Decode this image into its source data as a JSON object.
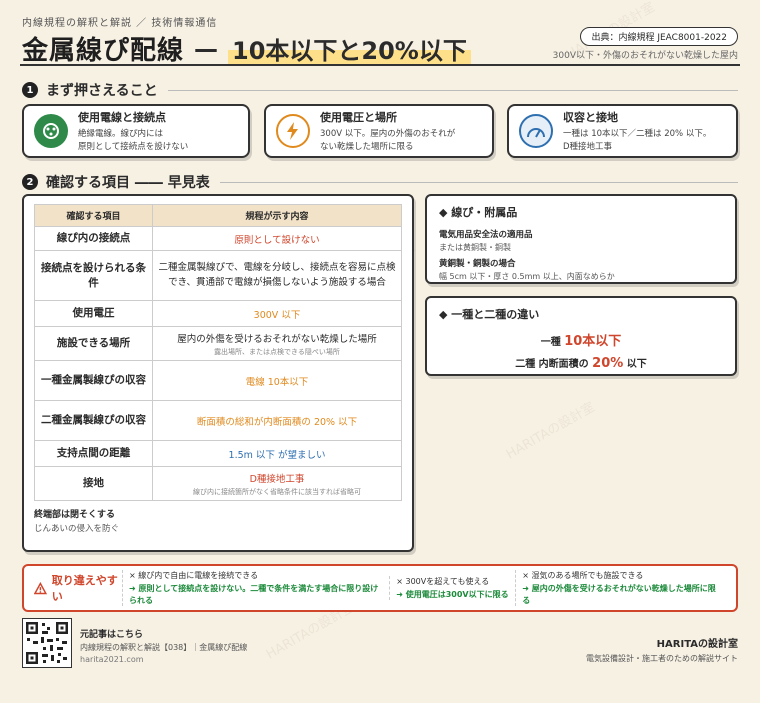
{
  "header": {
    "subtitle": "内線規程の解釈と解説 ／ 技術情報通信",
    "title_main": "金属線ぴ配線",
    "title_dash": "—",
    "title_highlight": "10本以下と20%以下",
    "source": "出典：内線規程 JEAC8001-2022",
    "note": "300V以下・外傷のおそれがない乾燥した屋内"
  },
  "section1": {
    "num": "1",
    "title": "まず押さえること",
    "cards": [
      {
        "title": "使用電線と接続点",
        "line1": "絶縁電線。線ぴ内には",
        "line2": "原則として接続点を設けない",
        "icon": "connector-icon",
        "color": "#2f8a4a"
      },
      {
        "title": "使用電圧と場所",
        "line1": "300V 以下。屋内の外傷のおそれが",
        "line2": "ない乾燥した場所に限る",
        "icon": "lightning-icon",
        "color": "#e08a1e"
      },
      {
        "title": "収容と接地",
        "line1": "一種は 10本以下／二種は 20% 以下。",
        "line2": "D種接地工事",
        "icon": "gauge-icon",
        "color": "#2e6fb0"
      }
    ]
  },
  "section2": {
    "num": "2",
    "title": "確認する項目 ―― 早見表"
  },
  "table": {
    "headers": [
      "確認する項目",
      "規程が示す内容"
    ],
    "rows": [
      {
        "label": "線ぴ内の接続点",
        "content": "原則として設けない",
        "sub": ""
      },
      {
        "label": "接続点を設けられる条件",
        "content": "二種金属製線ぴで、電線を分岐し、接続点を容易に点検でき、貫通部で電線が損傷しないよう施設する場合",
        "sub": ""
      },
      {
        "label": "使用電圧",
        "content": "300V 以下",
        "sub": ""
      },
      {
        "label": "施設できる場所",
        "content": "屋内の外傷を受けるおそれがない乾燥した場所",
        "sub": "露出場所、または点検できる隠ぺい場所"
      },
      {
        "label": "一種金属製線ぴの収容",
        "content": "電線 10本以下",
        "sub": ""
      },
      {
        "label": "二種金属製線ぴの収容",
        "content": "断面積の総和が内断面積の 20% 以下",
        "sub": ""
      },
      {
        "label": "支持点間の距離",
        "content": "1.5m 以下 が望ましい",
        "sub": ""
      },
      {
        "label": "接地",
        "content": "D種接地工事",
        "sub": "線ぴ内に接続箇所がなく省略条件に該当すれば省略可"
      }
    ],
    "foot_title": "終端部は閉そくする",
    "foot_text": "じんあいの侵入を防ぐ"
  },
  "side1": {
    "title": "◆ 線ぴ・附属品",
    "sub1": "電気用品安全法の適用品",
    "txt1": "または黄銅製・銅製",
    "sub2": "黄銅製・銅製の場合",
    "txt2": "幅 5cm 以下・厚さ 0.5mm 以上、内面なめらか"
  },
  "side2": {
    "title": "◆ 一種と二種の違い",
    "row1_pre": "一種",
    "row1_big": "10本以下",
    "row2_pre": "二種 内断面積の",
    "row2_big": "20%",
    "row2_post": "以下"
  },
  "warning": {
    "head": "取り違えやすい",
    "items": [
      {
        "x": "× 線ぴ内で自由に電線を接続できる",
        "ok": "➜ 原則として接続点を設けない。二種で条件を満たす場合に限り設けられる"
      },
      {
        "x": "× 300Vを超えても使える",
        "ok": "➜ 使用電圧は300V以下に限る"
      },
      {
        "x": "× 湿気のある場所でも施設できる",
        "ok": "➜ 屋内の外傷を受けるおそれがない乾燥した場所に限る"
      }
    ]
  },
  "footer": {
    "left1": "元記事はこちら",
    "left2": "内線規程の解釈と解説【038】｜金属線ぴ配線",
    "left3": "haritа2021.com",
    "right1": "HARITAの設計室",
    "right2": "電気設備設計・施工者のための解説サイト"
  }
}
